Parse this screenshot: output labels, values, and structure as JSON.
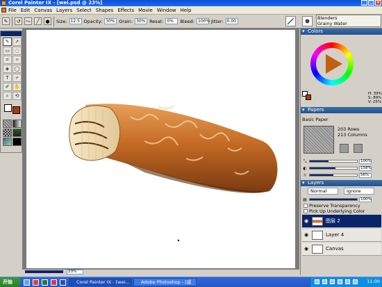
{
  "window": {
    "title": "Corel Painter IX - [wei.psd @ 23%]"
  },
  "menu": [
    "File",
    "Edit",
    "Canvas",
    "Layers",
    "Select",
    "Shapes",
    "Effects",
    "Movie",
    "Window",
    "Help"
  ],
  "property_bar": {
    "size_label": "Size:",
    "size_value": "12.5",
    "opacity_label": "Opacity:",
    "opacity_value": "30%",
    "grain_label": "Grain:",
    "grain_value": "30%",
    "resat_label": "Resat:",
    "resat_value": "0%",
    "bleed_label": "Bleed:",
    "bleed_value": "100%",
    "jitter_label": "Jitter:",
    "jitter_value": "0.00"
  },
  "brush_selector": {
    "category": "Blenders",
    "variant": "Grainy Water"
  },
  "panels": {
    "colors": {
      "title": "Colors",
      "hsv": {
        "h": "H: 39%",
        "s": "S: 89%",
        "v": "V: 25%"
      },
      "main_color": "#ffffff",
      "additional_color": "#a33d12"
    },
    "papers": {
      "title": "Papers",
      "paper_name": "Basic Paper",
      "rows": "203 Rows",
      "columns": "213 Columns",
      "scale": "100%",
      "contrast": "158%",
      "brightness": "56%"
    },
    "layers": {
      "title": "Layers",
      "composite_method": "Normal",
      "composite_depth": "Ignore",
      "opacity": "100%",
      "preserve_transparency": "Preserve Transparency",
      "pick_up_color": "Pick Up Underlying Color",
      "items": [
        {
          "name": "图层 2",
          "selected": true
        },
        {
          "name": "Layer 4",
          "selected": false
        },
        {
          "name": "Canvas",
          "selected": false
        }
      ]
    }
  },
  "status": {
    "zoom": "23%"
  },
  "taskbar": {
    "start_label": "开始",
    "tasks": [
      "Corel Painter IX - [wei...",
      "Adobe Photoshop - [威化..."
    ],
    "clock": "11:00"
  }
}
